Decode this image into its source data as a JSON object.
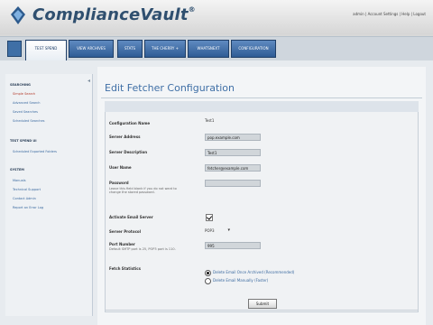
{
  "app": {
    "logo_text": "ComplianceVault",
    "user_links": "admin | Account Settings | Help | Logout"
  },
  "nav": {
    "tabs": [
      {
        "label": "TEST SPEND"
      },
      {
        "label": "VIEW ARCHIVES"
      },
      {
        "label": "STATS"
      },
      {
        "label": "THE CHERRY +"
      },
      {
        "label": "WHATSNEXT"
      },
      {
        "label": "CONFIGURATION"
      }
    ]
  },
  "sidebar": {
    "sections": [
      {
        "title": "SEARCHING",
        "items": [
          "Simple Search",
          "Advanced Search",
          "Saved Searches",
          "Scheduled Searches"
        ]
      },
      {
        "title": "TEST SPEND UI",
        "items": [
          "Scheduled Exported Folders"
        ]
      },
      {
        "title": "SYSTEM",
        "items": [
          "Manuals",
          "Technical Support",
          "Contact Admin",
          "Report an Error Log"
        ]
      }
    ]
  },
  "page": {
    "title": "Edit Fetcher Configuration"
  },
  "form": {
    "fields": [
      {
        "label": "Configuration Name",
        "value": "Test1"
      },
      {
        "label": "Server Address",
        "value": "pop.example.com"
      },
      {
        "label": "Server Description",
        "value": "Test1"
      },
      {
        "label": "User Name",
        "value": "fetcher@example.com"
      },
      {
        "label": "Password",
        "help": "Leave this field blank if you do not want to change the stored password."
      },
      {
        "label": "Activate Email Server",
        "checked": true
      },
      {
        "label": "Server Protocol",
        "value": "POP3"
      },
      {
        "label": "Port Number",
        "help": "Default SMTP port is 25, POP3 port is 110.",
        "value": "995"
      },
      {
        "label": "Fetch Statistics"
      }
    ],
    "radio_options": [
      {
        "label": "Delete Email Once Archived (Recommended)",
        "checked": true
      },
      {
        "label": "Delete Email Manually (Faster)",
        "checked": false
      }
    ],
    "submit_label": "Submit"
  }
}
